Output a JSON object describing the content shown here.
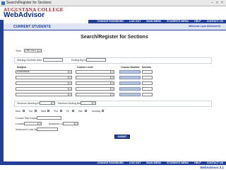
{
  "window": {
    "title": "Search/Register for Sections"
  },
  "brand": {
    "college": "AUGUSTANA COLLEGE",
    "product": "WebAdvisor"
  },
  "nav": {
    "items": [
      "CHANGE PASSWORD",
      "LOG OUT",
      "MAIN MENU",
      "STUDENTS MENU",
      "HELP",
      "CONTACT US"
    ]
  },
  "section_title": "CURRENT STUDENTS",
  "welcome": "Welcome Lynn (Dehwerd!)",
  "page": {
    "title": "Search/Register for Sections"
  },
  "form": {
    "term_label": "Term",
    "term_value": "Fall 2013",
    "start_date_label": "Starting On/After Date",
    "end_date_label": "Ending By Date",
    "columns": {
      "subject": "Subject",
      "course_level": "Course Level",
      "course_number": "Course Number",
      "section": "Section"
    },
    "subject_first": "Economics",
    "meeting_after_label": "Sections Meeting After",
    "ending_before_label": "Sections Ending Before",
    "days": [
      "Mon",
      "Tue",
      "Wed",
      "Thu",
      "Fri",
      "Sat",
      "Sunday"
    ],
    "course_title_label": "Course Title Keywords",
    "location_label": "Location",
    "academic_level_label": "Academic Level",
    "instructor_label": "Instructor's Last Name",
    "submit_label": "SUBMIT"
  },
  "footer": {
    "items": [
      "CHANGE PASSWORD",
      "LOG OUT",
      "MAIN MENU",
      "STUDENTS MENU",
      "HELP",
      "CONTACT US"
    ],
    "badge": "WebAdvisor 3.1"
  }
}
